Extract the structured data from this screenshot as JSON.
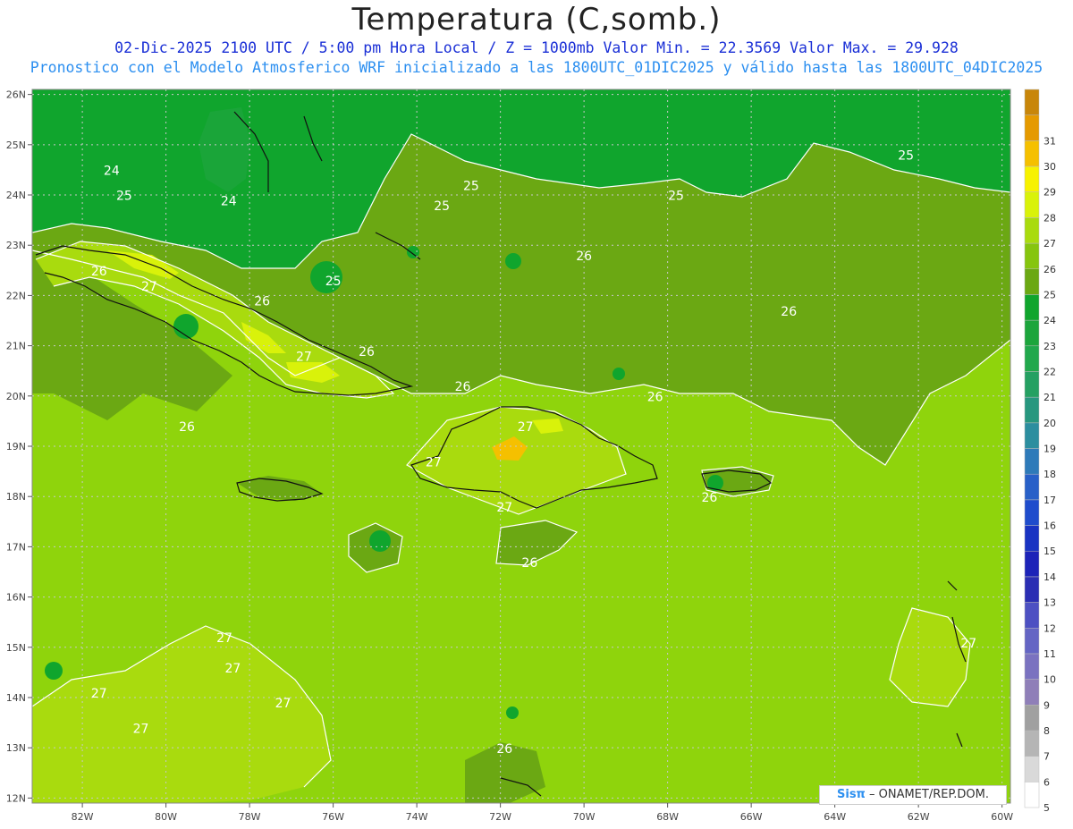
{
  "header": {
    "title": "Temperatura (C,somb.)",
    "line1": "02-Dic-2025  2100 UTC / 5:00 pm Hora Local / Z = 1000mb    Valor Min. = 22.3569  Valor Max. = 29.928",
    "line2": "Pronostico con el Modelo Atmosferico WRF inicializado a las 1800UTC_01DIC2025 y válido hasta las  1800UTC_04DIC2025"
  },
  "map": {
    "lon_labels": [
      "82W",
      "80W",
      "78W",
      "76W",
      "74W",
      "72W",
      "70W",
      "68W",
      "66W",
      "64W",
      "62W",
      "60W"
    ],
    "lat_labels": [
      "26N",
      "25N",
      "24N",
      "23N",
      "22N",
      "21N",
      "20N",
      "19N",
      "18N",
      "17N",
      "16N",
      "15N",
      "14N",
      "13N",
      "12N"
    ],
    "lon_range": [
      -83.2,
      -59.8
    ],
    "lat_range": [
      11.9,
      26.1
    ],
    "contour_labels": [
      {
        "text": "24",
        "lon": -81.3,
        "lat": 24.4
      },
      {
        "text": "24",
        "lon": -78.5,
        "lat": 23.8
      },
      {
        "text": "25",
        "lon": -81.0,
        "lat": 23.9
      },
      {
        "text": "25",
        "lon": -76.0,
        "lat": 22.2
      },
      {
        "text": "25",
        "lon": -72.7,
        "lat": 24.1
      },
      {
        "text": "25",
        "lon": -73.4,
        "lat": 23.7
      },
      {
        "text": "25",
        "lon": -67.8,
        "lat": 23.9
      },
      {
        "text": "25",
        "lon": -62.3,
        "lat": 24.7
      },
      {
        "text": "26",
        "lon": -81.6,
        "lat": 22.4
      },
      {
        "text": "26",
        "lon": -77.7,
        "lat": 21.8
      },
      {
        "text": "26",
        "lon": -75.2,
        "lat": 20.8
      },
      {
        "text": "26",
        "lon": -79.5,
        "lat": 19.3
      },
      {
        "text": "26",
        "lon": -70.0,
        "lat": 22.7
      },
      {
        "text": "26",
        "lon": -72.9,
        "lat": 20.1
      },
      {
        "text": "26",
        "lon": -68.3,
        "lat": 19.9
      },
      {
        "text": "26",
        "lon": -65.1,
        "lat": 21.6
      },
      {
        "text": "26",
        "lon": -67.0,
        "lat": 17.9
      },
      {
        "text": "26",
        "lon": -71.3,
        "lat": 16.6
      },
      {
        "text": "26",
        "lon": -71.9,
        "lat": 12.9
      },
      {
        "text": "27",
        "lon": -80.4,
        "lat": 22.1
      },
      {
        "text": "27",
        "lon": -76.7,
        "lat": 20.7
      },
      {
        "text": "27",
        "lon": -73.6,
        "lat": 18.6
      },
      {
        "text": "27",
        "lon": -71.4,
        "lat": 19.3
      },
      {
        "text": "27",
        "lon": -71.9,
        "lat": 17.7
      },
      {
        "text": "27",
        "lon": -78.6,
        "lat": 15.1
      },
      {
        "text": "27",
        "lon": -78.4,
        "lat": 14.5
      },
      {
        "text": "27",
        "lon": -77.2,
        "lat": 13.8
      },
      {
        "text": "27",
        "lon": -81.6,
        "lat": 14.0
      },
      {
        "text": "27",
        "lon": -80.6,
        "lat": 13.3
      },
      {
        "text": "27",
        "lon": -60.8,
        "lat": 15.0
      }
    ]
  },
  "colorbar": {
    "values": [
      "5",
      "6",
      "7",
      "8",
      "9",
      "10",
      "11",
      "12",
      "13",
      "14",
      "15",
      "16",
      "17",
      "18",
      "19",
      "20",
      "21",
      "22",
      "23",
      "24",
      "25",
      "26",
      "27",
      "28",
      "29",
      "30",
      "31"
    ],
    "colors": [
      "#ffffff",
      "#d9d9d9",
      "#b5b5b5",
      "#a0a0a0",
      "#8f7fb8",
      "#7a72c0",
      "#6465c4",
      "#4d50c2",
      "#2b2eb3",
      "#1d23b8",
      "#1933c2",
      "#1f4ccc",
      "#2860c8",
      "#2e7ab9",
      "#2c8e9f",
      "#27977f",
      "#25a062",
      "#21a84c",
      "#1ca53c",
      "#10a52d",
      "#6ba813",
      "#86c50e",
      "#a9db0e",
      "#d9f20a",
      "#f7f200",
      "#f5c000",
      "#e59a00",
      "#c8860a"
    ]
  },
  "credit": {
    "sis": "Sisπ",
    "text": " – ONAMET/REP.DOM."
  }
}
